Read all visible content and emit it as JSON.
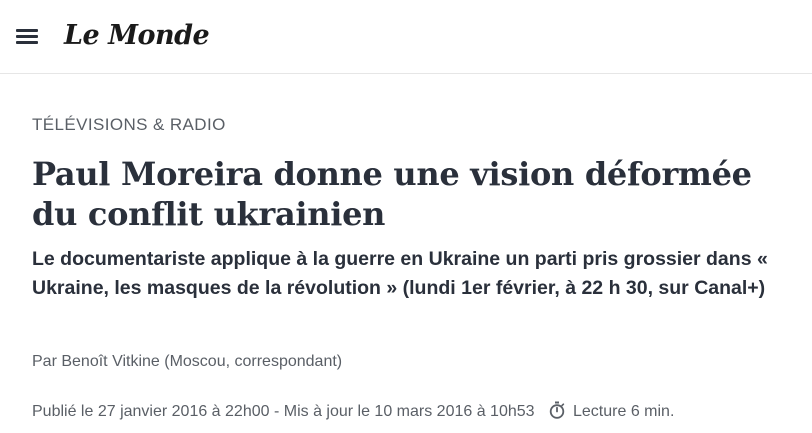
{
  "header": {
    "menu_icon": "hamburger-menu-icon",
    "logo_text": "Le Monde"
  },
  "article": {
    "rubric": "TÉLÉVISIONS & RADIO",
    "title": "Paul Moreira donne une vision déformée du conflit ukrainien",
    "standfirst": "Le documentariste applique à la guerre en Ukraine un parti pris grossier dans « Ukraine, les masques de la révolution » (lundi 1er février, à 22 h 30, sur Canal+)",
    "byline_prefix": "Par",
    "author": "Benoît Vitkine",
    "author_role": "(Moscou, correspondant)",
    "published": "Publié le 27 janvier 2016 à 22h00",
    "separator": " - ",
    "updated": "Mis à jour le 10 mars 2016 à 10h53",
    "reading_time": "Lecture 6 min.",
    "reading_icon": "stopwatch-icon"
  },
  "colors": {
    "text": "#2a303b",
    "muted": "#5a5f66",
    "divider": "#e6e6e6"
  }
}
